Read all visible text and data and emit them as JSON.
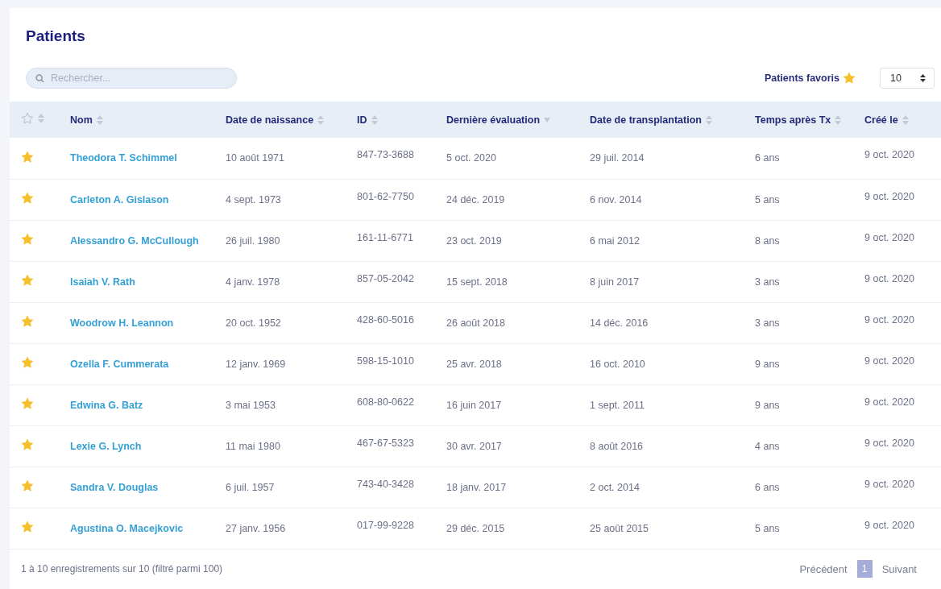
{
  "title": "Patients",
  "search": {
    "placeholder": "Rechercher..."
  },
  "favorites_filter": {
    "label": "Patients favoris",
    "on": true
  },
  "page_size": "10",
  "columns": [
    {
      "kind": "star",
      "sorted": false
    },
    {
      "label": "Nom",
      "kind": "text",
      "sorted": false
    },
    {
      "label": "Date de naissance",
      "kind": "text",
      "sorted": false
    },
    {
      "label": "ID",
      "kind": "text",
      "sorted": false
    },
    {
      "label": "Dernière évaluation",
      "kind": "text",
      "sorted": true
    },
    {
      "label": "Date de transplantation",
      "kind": "text",
      "sorted": false
    },
    {
      "label": "Temps après Tx",
      "kind": "text",
      "sorted": false
    },
    {
      "label": "Créé le",
      "kind": "text",
      "sorted": false
    }
  ],
  "rows": [
    {
      "favorite": true,
      "name": "Theodora T. Schimmel",
      "birth": "10 août 1971",
      "id": "847-73-3688",
      "last_eval": "5 oct. 2020",
      "transplant": "29 juil. 2014",
      "time_after": "6 ans",
      "created": "9 oct. 2020"
    },
    {
      "favorite": true,
      "name": "Carleton A. Gislason",
      "birth": "4 sept. 1973",
      "id": "801-62-7750",
      "last_eval": "24 déc. 2019",
      "transplant": "6 nov. 2014",
      "time_after": "5 ans",
      "created": "9 oct. 2020"
    },
    {
      "favorite": true,
      "name": "Alessandro G. McCullough",
      "birth": "26 juil. 1980",
      "id": "161-11-6771",
      "last_eval": "23 oct. 2019",
      "transplant": "6 mai 2012",
      "time_after": "8 ans",
      "created": "9 oct. 2020"
    },
    {
      "favorite": true,
      "name": "Isaiah V. Rath",
      "birth": "4 janv. 1978",
      "id": "857-05-2042",
      "last_eval": "15 sept. 2018",
      "transplant": "8 juin 2017",
      "time_after": "3 ans",
      "created": "9 oct. 2020"
    },
    {
      "favorite": true,
      "name": "Woodrow H. Leannon",
      "birth": "20 oct. 1952",
      "id": "428-60-5016",
      "last_eval": "26 août 2018",
      "transplant": "14 déc. 2016",
      "time_after": "3 ans",
      "created": "9 oct. 2020"
    },
    {
      "favorite": true,
      "name": "Ozella F. Cummerata",
      "birth": "12 janv. 1969",
      "id": "598-15-1010",
      "last_eval": "25 avr. 2018",
      "transplant": "16 oct. 2010",
      "time_after": "9 ans",
      "created": "9 oct. 2020"
    },
    {
      "favorite": true,
      "name": "Edwina G. Batz",
      "birth": "3 mai 1953",
      "id": "608-80-0622",
      "last_eval": "16 juin 2017",
      "transplant": "1 sept. 2011",
      "time_after": "9 ans",
      "created": "9 oct. 2020"
    },
    {
      "favorite": true,
      "name": "Lexie G. Lynch",
      "birth": "11 mai 1980",
      "id": "467-67-5323",
      "last_eval": "30 avr. 2017",
      "transplant": "8 août 2016",
      "time_after": "4 ans",
      "created": "9 oct. 2020"
    },
    {
      "favorite": true,
      "name": "Sandra V. Douglas",
      "birth": "6 juil. 1957",
      "id": "743-40-3428",
      "last_eval": "18 janv. 2017",
      "transplant": "2 oct. 2014",
      "time_after": "6 ans",
      "created": "9 oct. 2020"
    },
    {
      "favorite": true,
      "name": "Agustina O. Macejkovic",
      "birth": "27 janv. 1956",
      "id": "017-99-9228",
      "last_eval": "29 déc. 2015",
      "transplant": "25 août 2015",
      "time_after": "5 ans",
      "created": "9 oct. 2020"
    }
  ],
  "footer": {
    "info": "1 à 10 enregistrements sur 10 (filtré parmi 100)",
    "previous": "Précédent",
    "pages": [
      {
        "label": "1",
        "selected": true
      }
    ],
    "next": "Suivant"
  }
}
